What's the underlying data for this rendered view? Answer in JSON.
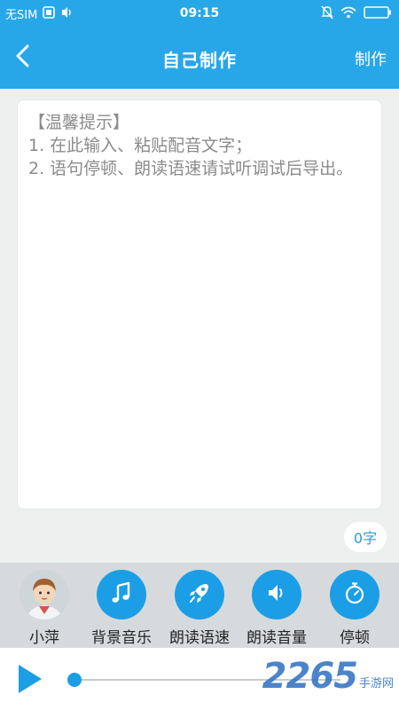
{
  "status_bar": {
    "carrier": "无SIM",
    "time": "09:15"
  },
  "nav": {
    "title": "自己制作",
    "action_label": "制作"
  },
  "editor": {
    "placeholder": "【温馨提示】\n1. 在此输入、粘贴配音文字；\n2. 语句停顿、朗读语速请试听调试后导出。",
    "value": ""
  },
  "word_count": "0字",
  "toolbar": {
    "items": [
      {
        "label": "小萍",
        "icon": "avatar"
      },
      {
        "label": "背景音乐",
        "icon": "music-note-icon"
      },
      {
        "label": "朗读语速",
        "icon": "rocket-icon"
      },
      {
        "label": "朗读音量",
        "icon": "speaker-icon"
      },
      {
        "label": "停顿",
        "icon": "stopwatch-icon"
      }
    ]
  },
  "player": {
    "progress": 0
  },
  "watermark": {
    "number": "2265",
    "text": "手游网"
  },
  "colors": {
    "primary": "#27a7e8",
    "accent": "#1b9ee5",
    "toolbar_bg": "#d6dadc"
  }
}
